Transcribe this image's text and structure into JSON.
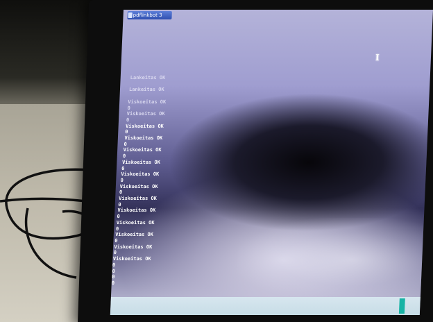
{
  "taskbar": {
    "window_tab_label": "pdflinkbot 3"
  },
  "cursor_glyph": "I",
  "console": {
    "lines": [
      {
        "text": "Lankeitas OK",
        "tone": "dim"
      },
      {
        "text": "",
        "tone": "dim"
      },
      {
        "text": "Lankeitas OK",
        "tone": "dim"
      },
      {
        "text": "",
        "tone": "dim"
      },
      {
        "text": "Viskoeitas OK",
        "tone": "dim"
      },
      {
        "text": "0",
        "tone": "dim"
      },
      {
        "text": "Viskoeitas OK",
        "tone": "dim"
      },
      {
        "text": "0",
        "tone": "dim"
      },
      {
        "text": "Viskoeitas OK",
        "tone": "bright"
      },
      {
        "text": "0",
        "tone": "bright"
      },
      {
        "text": "Viskoeitas OK",
        "tone": "bright"
      },
      {
        "text": "0",
        "tone": "bright"
      },
      {
        "text": "Viskoeitas OK",
        "tone": "bright"
      },
      {
        "text": "0",
        "tone": "bright"
      },
      {
        "text": "Viskoeitas OK",
        "tone": "bright"
      },
      {
        "text": "0",
        "tone": "bright"
      },
      {
        "text": "Viskoeitas OK",
        "tone": "bright"
      },
      {
        "text": "0",
        "tone": "bright"
      },
      {
        "text": "Viskoeitas OK",
        "tone": "bright"
      },
      {
        "text": "0",
        "tone": "bright"
      },
      {
        "text": "Viskoeitas OK",
        "tone": "bright"
      },
      {
        "text": "0",
        "tone": "bright"
      },
      {
        "text": "Viskoeitas OK",
        "tone": "bright"
      },
      {
        "text": "0",
        "tone": "bright"
      },
      {
        "text": "Viskoeitas OK",
        "tone": "bright"
      },
      {
        "text": "0",
        "tone": "bright"
      },
      {
        "text": "Viskoeitas OK",
        "tone": "bright"
      },
      {
        "text": "0",
        "tone": "bright"
      },
      {
        "text": "Viskoeitas OK",
        "tone": "bright"
      },
      {
        "text": "0",
        "tone": "bright"
      },
      {
        "text": "Viskoeitas OK",
        "tone": "bright"
      },
      {
        "text": "0",
        "tone": "bright"
      },
      {
        "text": "0",
        "tone": "bright"
      },
      {
        "text": "0",
        "tone": "bright"
      },
      {
        "text": "0",
        "tone": "bright"
      }
    ]
  },
  "colors": {
    "screen_top": "#b4b3d9",
    "console_text": "#ffffff",
    "taskbar_tab": "#2f4fb0",
    "bottom_bar": "#d7e6ef",
    "accent_teal": "#17b3a5"
  }
}
